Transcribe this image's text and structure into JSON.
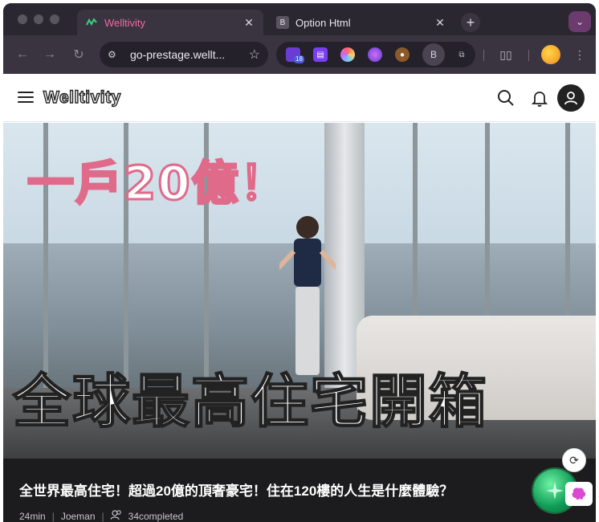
{
  "browser": {
    "tabs": [
      {
        "label": "Welltivity",
        "active": true,
        "favicon": "welltivity-logo"
      },
      {
        "label": "Option Html",
        "active": false,
        "favicon": "B"
      }
    ],
    "new_tab": "+",
    "tab_search": "⌄",
    "url": "go-prestage.wellt...",
    "extension_badge": "18",
    "extension_letter": "B"
  },
  "app": {
    "brand": "Welltivity",
    "icons": [
      "menu-icon",
      "search-icon",
      "bell-icon",
      "profile-icon"
    ]
  },
  "hero": {
    "overlay_top": "一戶20億！",
    "overlay_bottom": "全球最高住宅開箱"
  },
  "caption": {
    "title": "全世界最高住宅！超過20億的頂奢豪宅！住在120樓的人生是什麼體驗？",
    "duration": "24min",
    "author": "Joeman",
    "completed": "34completed"
  },
  "colors": {
    "accent_pink": "#e06a8a",
    "tab_bg": "#3a3441",
    "chrome_bg": "#2b2730",
    "caption_bg": "#1c1b1d"
  }
}
